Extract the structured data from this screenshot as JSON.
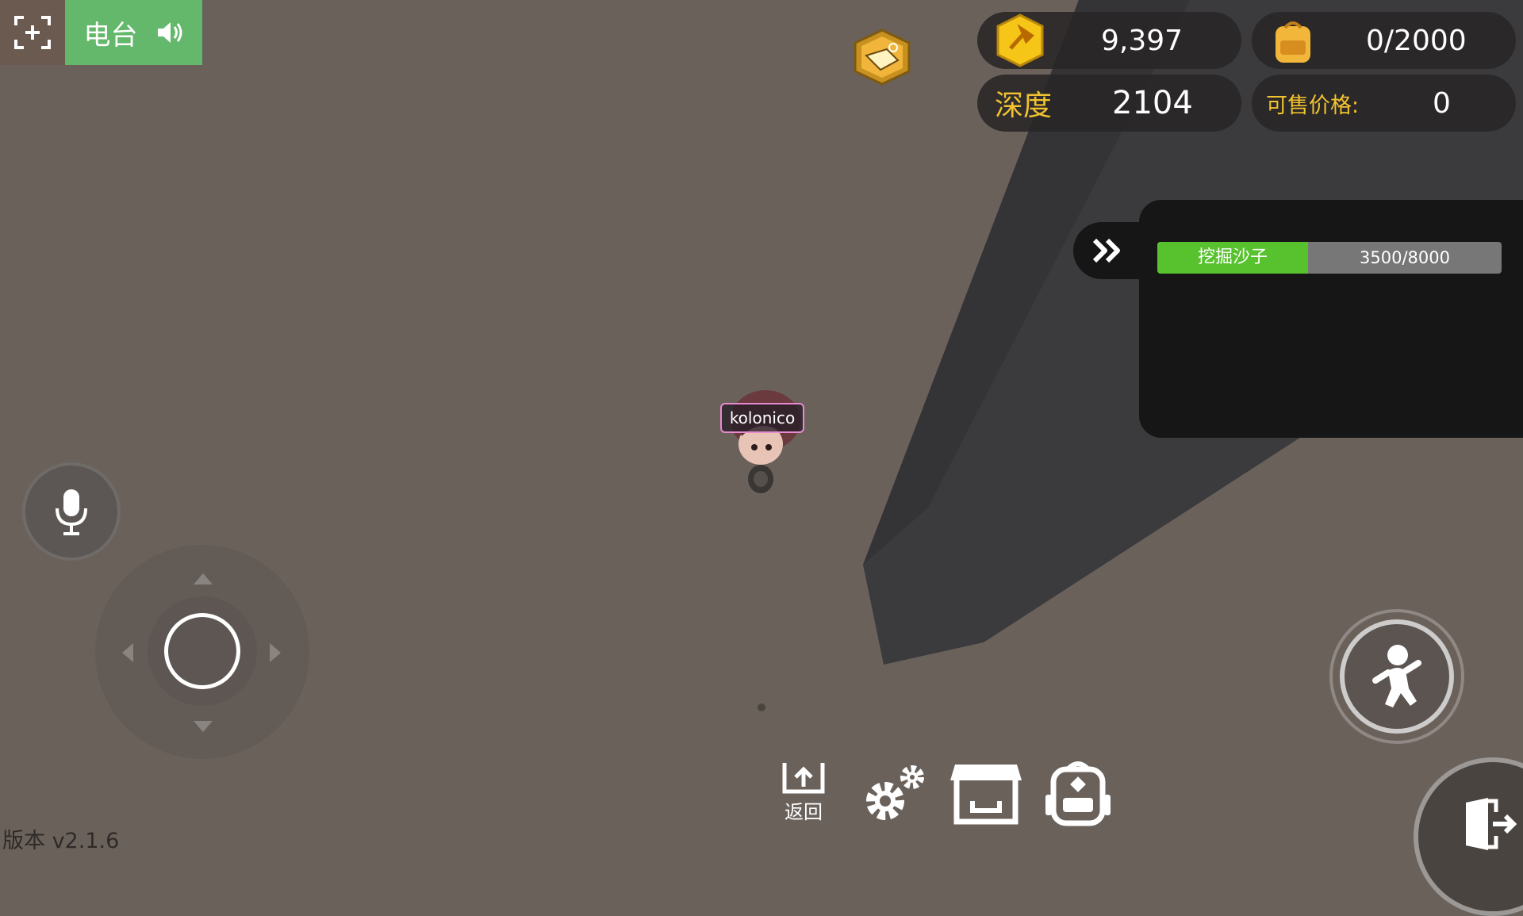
{
  "radio": {
    "label": "电台"
  },
  "stats": {
    "coins": "9,397",
    "bag_capacity": "0/2000",
    "depth_label": "深度",
    "depth_value": "2104",
    "price_label": "可售价格:",
    "price_value": "0"
  },
  "task": {
    "name": "挖掘沙子",
    "progress": "3500/8000",
    "current": 3500,
    "total": 8000
  },
  "player": {
    "name": "kolonico"
  },
  "toolbar": {
    "back_label": "返回"
  },
  "version": "版本 v2.1.6",
  "colors": {
    "radio_bg": "#64b86b",
    "accent_gold": "#f2c230",
    "progress_fill": "#58c12e",
    "name_border": "#e88ad0"
  },
  "icons": [
    "fullscreen-icon",
    "speaker-icon",
    "boost-icon",
    "coin-shovel-icon",
    "backpack-icon",
    "double-chevron-icon",
    "microphone-icon",
    "back-icon",
    "settings-icon",
    "shop-icon",
    "bag-icon",
    "jump-icon",
    "exit-icon"
  ]
}
